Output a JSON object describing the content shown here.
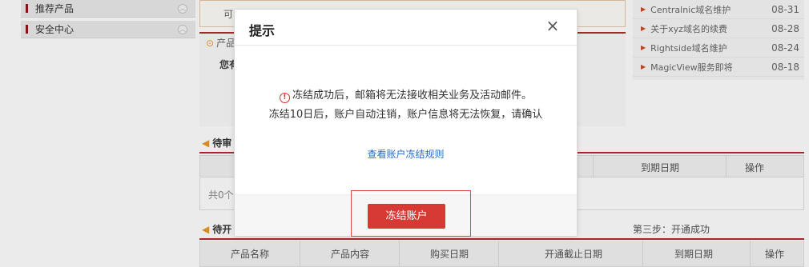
{
  "sidebar": {
    "items": [
      {
        "label": "推荐产品"
      },
      {
        "label": "安全中心"
      }
    ]
  },
  "background": {
    "top_box_peek": "可",
    "product_section_title": "产品",
    "product_section_desc": "您有",
    "pending_section_title": "待审",
    "pending_table": {
      "headers": [
        "到期日期",
        "操作"
      ],
      "total_text": "共0个"
    },
    "open_section_title": "待开",
    "step3_label": "第三步：开通成功",
    "open_table": {
      "headers": [
        "产品名称",
        "产品内容",
        "购买日期",
        "开通截止日期",
        "到期日期",
        "操作"
      ]
    }
  },
  "news": {
    "items": [
      {
        "title": "Centralnic域名维护",
        "date": "08-31"
      },
      {
        "title": "关于xyz域名的续费",
        "date": "08-28"
      },
      {
        "title": "Rightside域名维护",
        "date": "08-24"
      },
      {
        "title": "MagicView服务即将",
        "date": "08-18"
      }
    ]
  },
  "dialog": {
    "title": "提示",
    "close_glyph": "×",
    "message_line1": "冻结成功后，邮箱将无法接收相关业务及活动邮件。",
    "message_line2": "冻结10日后，账户自动注销，账户信息将无法恢复，请确认",
    "rules_link": "查看账户冻结规则",
    "confirm_button": "冻结账户"
  },
  "colors": {
    "accent_red": "#d73a35",
    "section_line": "#b52b2b",
    "link_blue": "#2a6bc4",
    "warning_red": "#d9302b"
  }
}
